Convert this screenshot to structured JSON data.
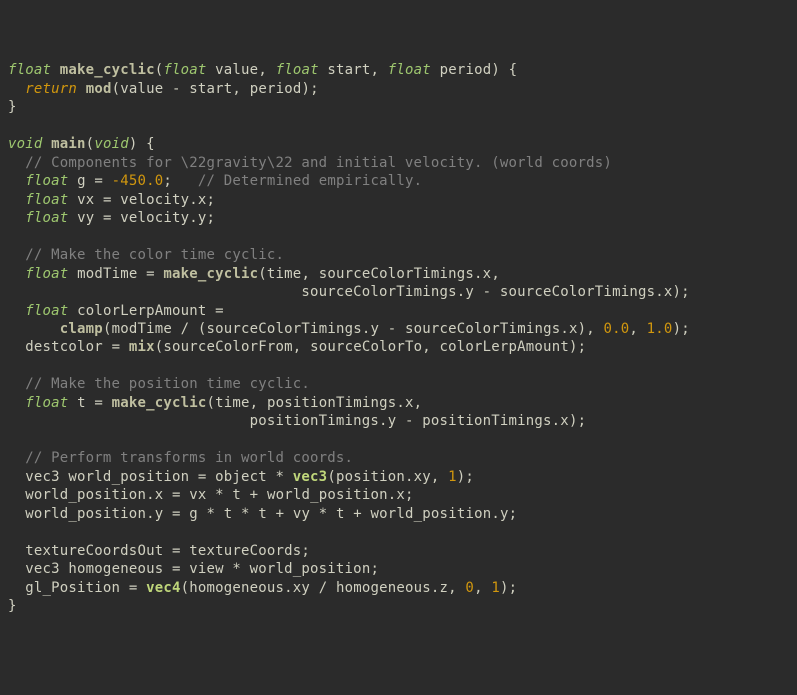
{
  "code": {
    "lines": [
      [
        {
          "t": "type",
          "s": "float"
        },
        {
          "t": "sp",
          "s": " "
        },
        {
          "t": "func",
          "s": "make_cyclic"
        },
        {
          "t": "punct",
          "s": "("
        },
        {
          "t": "type",
          "s": "float"
        },
        {
          "t": "sp",
          "s": " "
        },
        {
          "t": "ident",
          "s": "value"
        },
        {
          "t": "punct",
          "s": ", "
        },
        {
          "t": "type",
          "s": "float"
        },
        {
          "t": "sp",
          "s": " "
        },
        {
          "t": "ident",
          "s": "start"
        },
        {
          "t": "punct",
          "s": ", "
        },
        {
          "t": "type",
          "s": "float"
        },
        {
          "t": "sp",
          "s": " "
        },
        {
          "t": "ident",
          "s": "period"
        },
        {
          "t": "punct",
          "s": ") {"
        }
      ],
      [
        {
          "t": "sp",
          "s": "  "
        },
        {
          "t": "kw",
          "s": "return"
        },
        {
          "t": "sp",
          "s": " "
        },
        {
          "t": "func",
          "s": "mod"
        },
        {
          "t": "punct",
          "s": "("
        },
        {
          "t": "ident",
          "s": "value"
        },
        {
          "t": "op",
          "s": " - "
        },
        {
          "t": "ident",
          "s": "start"
        },
        {
          "t": "punct",
          "s": ", "
        },
        {
          "t": "ident",
          "s": "period"
        },
        {
          "t": "punct",
          "s": ");"
        }
      ],
      [
        {
          "t": "punct",
          "s": "}"
        }
      ],
      [
        {
          "t": "sp",
          "s": ""
        }
      ],
      [
        {
          "t": "type",
          "s": "void"
        },
        {
          "t": "sp",
          "s": " "
        },
        {
          "t": "func",
          "s": "main"
        },
        {
          "t": "punct",
          "s": "("
        },
        {
          "t": "type",
          "s": "void"
        },
        {
          "t": "punct",
          "s": ") {"
        }
      ],
      [
        {
          "t": "sp",
          "s": "  "
        },
        {
          "t": "comment",
          "s": "// Components for \\22gravity\\22 and initial velocity. (world coords)"
        }
      ],
      [
        {
          "t": "sp",
          "s": "  "
        },
        {
          "t": "type",
          "s": "float"
        },
        {
          "t": "sp",
          "s": " "
        },
        {
          "t": "ident",
          "s": "g"
        },
        {
          "t": "op",
          "s": " = "
        },
        {
          "t": "num",
          "s": "-450.0"
        },
        {
          "t": "punct",
          "s": ";"
        },
        {
          "t": "sp",
          "s": "   "
        },
        {
          "t": "comment",
          "s": "// Determined empirically."
        }
      ],
      [
        {
          "t": "sp",
          "s": "  "
        },
        {
          "t": "type",
          "s": "float"
        },
        {
          "t": "sp",
          "s": " "
        },
        {
          "t": "ident",
          "s": "vx"
        },
        {
          "t": "op",
          "s": " = "
        },
        {
          "t": "ident",
          "s": "velocity"
        },
        {
          "t": "punct",
          "s": "."
        },
        {
          "t": "ident",
          "s": "x"
        },
        {
          "t": "punct",
          "s": ";"
        }
      ],
      [
        {
          "t": "sp",
          "s": "  "
        },
        {
          "t": "type",
          "s": "float"
        },
        {
          "t": "sp",
          "s": " "
        },
        {
          "t": "ident",
          "s": "vy"
        },
        {
          "t": "op",
          "s": " = "
        },
        {
          "t": "ident",
          "s": "velocity"
        },
        {
          "t": "punct",
          "s": "."
        },
        {
          "t": "ident",
          "s": "y"
        },
        {
          "t": "punct",
          "s": ";"
        }
      ],
      [
        {
          "t": "sp",
          "s": ""
        }
      ],
      [
        {
          "t": "sp",
          "s": "  "
        },
        {
          "t": "comment",
          "s": "// Make the color time cyclic."
        }
      ],
      [
        {
          "t": "sp",
          "s": "  "
        },
        {
          "t": "type",
          "s": "float"
        },
        {
          "t": "sp",
          "s": " "
        },
        {
          "t": "ident",
          "s": "modTime"
        },
        {
          "t": "op",
          "s": " = "
        },
        {
          "t": "func",
          "s": "make_cyclic"
        },
        {
          "t": "punct",
          "s": "("
        },
        {
          "t": "ident",
          "s": "time"
        },
        {
          "t": "punct",
          "s": ", "
        },
        {
          "t": "ident",
          "s": "sourceColorTimings"
        },
        {
          "t": "punct",
          "s": "."
        },
        {
          "t": "ident",
          "s": "x"
        },
        {
          "t": "punct",
          "s": ","
        }
      ],
      [
        {
          "t": "sp",
          "s": "                                  "
        },
        {
          "t": "ident",
          "s": "sourceColorTimings"
        },
        {
          "t": "punct",
          "s": "."
        },
        {
          "t": "ident",
          "s": "y"
        },
        {
          "t": "op",
          "s": " - "
        },
        {
          "t": "ident",
          "s": "sourceColorTimings"
        },
        {
          "t": "punct",
          "s": "."
        },
        {
          "t": "ident",
          "s": "x"
        },
        {
          "t": "punct",
          "s": ");"
        }
      ],
      [
        {
          "t": "sp",
          "s": "  "
        },
        {
          "t": "type",
          "s": "float"
        },
        {
          "t": "sp",
          "s": " "
        },
        {
          "t": "ident",
          "s": "colorLerpAmount"
        },
        {
          "t": "op",
          "s": " ="
        }
      ],
      [
        {
          "t": "sp",
          "s": "      "
        },
        {
          "t": "func",
          "s": "clamp"
        },
        {
          "t": "punct",
          "s": "("
        },
        {
          "t": "ident",
          "s": "modTime"
        },
        {
          "t": "op",
          "s": " / "
        },
        {
          "t": "punct",
          "s": "("
        },
        {
          "t": "ident",
          "s": "sourceColorTimings"
        },
        {
          "t": "punct",
          "s": "."
        },
        {
          "t": "ident",
          "s": "y"
        },
        {
          "t": "op",
          "s": " - "
        },
        {
          "t": "ident",
          "s": "sourceColorTimings"
        },
        {
          "t": "punct",
          "s": "."
        },
        {
          "t": "ident",
          "s": "x"
        },
        {
          "t": "punct",
          "s": "), "
        },
        {
          "t": "num",
          "s": "0.0"
        },
        {
          "t": "punct",
          "s": ", "
        },
        {
          "t": "num",
          "s": "1.0"
        },
        {
          "t": "punct",
          "s": ");"
        }
      ],
      [
        {
          "t": "sp",
          "s": "  "
        },
        {
          "t": "ident",
          "s": "destcolor"
        },
        {
          "t": "op",
          "s": " = "
        },
        {
          "t": "func",
          "s": "mix"
        },
        {
          "t": "punct",
          "s": "("
        },
        {
          "t": "ident",
          "s": "sourceColorFrom"
        },
        {
          "t": "punct",
          "s": ", "
        },
        {
          "t": "ident",
          "s": "sourceColorTo"
        },
        {
          "t": "punct",
          "s": ", "
        },
        {
          "t": "ident",
          "s": "colorLerpAmount"
        },
        {
          "t": "punct",
          "s": ");"
        }
      ],
      [
        {
          "t": "sp",
          "s": ""
        }
      ],
      [
        {
          "t": "sp",
          "s": "  "
        },
        {
          "t": "comment",
          "s": "// Make the position time cyclic."
        }
      ],
      [
        {
          "t": "sp",
          "s": "  "
        },
        {
          "t": "type",
          "s": "float"
        },
        {
          "t": "sp",
          "s": " "
        },
        {
          "t": "ident",
          "s": "t"
        },
        {
          "t": "op",
          "s": " = "
        },
        {
          "t": "func",
          "s": "make_cyclic"
        },
        {
          "t": "punct",
          "s": "("
        },
        {
          "t": "ident",
          "s": "time"
        },
        {
          "t": "punct",
          "s": ", "
        },
        {
          "t": "ident",
          "s": "positionTimings"
        },
        {
          "t": "punct",
          "s": "."
        },
        {
          "t": "ident",
          "s": "x"
        },
        {
          "t": "punct",
          "s": ","
        }
      ],
      [
        {
          "t": "sp",
          "s": "                            "
        },
        {
          "t": "ident",
          "s": "positionTimings"
        },
        {
          "t": "punct",
          "s": "."
        },
        {
          "t": "ident",
          "s": "y"
        },
        {
          "t": "op",
          "s": " - "
        },
        {
          "t": "ident",
          "s": "positionTimings"
        },
        {
          "t": "punct",
          "s": "."
        },
        {
          "t": "ident",
          "s": "x"
        },
        {
          "t": "punct",
          "s": ");"
        }
      ],
      [
        {
          "t": "sp",
          "s": ""
        }
      ],
      [
        {
          "t": "sp",
          "s": "  "
        },
        {
          "t": "comment",
          "s": "// Perform transforms in world coords."
        }
      ],
      [
        {
          "t": "sp",
          "s": "  "
        },
        {
          "t": "ident",
          "s": "vec3"
        },
        {
          "t": "sp",
          "s": " "
        },
        {
          "t": "ident",
          "s": "world_position"
        },
        {
          "t": "op",
          "s": " = "
        },
        {
          "t": "ident",
          "s": "object"
        },
        {
          "t": "op",
          "s": " * "
        },
        {
          "t": "builtin",
          "s": "vec3"
        },
        {
          "t": "punct",
          "s": "("
        },
        {
          "t": "ident",
          "s": "position"
        },
        {
          "t": "punct",
          "s": "."
        },
        {
          "t": "ident",
          "s": "xy"
        },
        {
          "t": "punct",
          "s": ", "
        },
        {
          "t": "num",
          "s": "1"
        },
        {
          "t": "punct",
          "s": ");"
        }
      ],
      [
        {
          "t": "sp",
          "s": "  "
        },
        {
          "t": "ident",
          "s": "world_position"
        },
        {
          "t": "punct",
          "s": "."
        },
        {
          "t": "ident",
          "s": "x"
        },
        {
          "t": "op",
          "s": " = "
        },
        {
          "t": "ident",
          "s": "vx"
        },
        {
          "t": "op",
          "s": " * "
        },
        {
          "t": "ident",
          "s": "t"
        },
        {
          "t": "op",
          "s": " + "
        },
        {
          "t": "ident",
          "s": "world_position"
        },
        {
          "t": "punct",
          "s": "."
        },
        {
          "t": "ident",
          "s": "x"
        },
        {
          "t": "punct",
          "s": ";"
        }
      ],
      [
        {
          "t": "sp",
          "s": "  "
        },
        {
          "t": "ident",
          "s": "world_position"
        },
        {
          "t": "punct",
          "s": "."
        },
        {
          "t": "ident",
          "s": "y"
        },
        {
          "t": "op",
          "s": " = "
        },
        {
          "t": "ident",
          "s": "g"
        },
        {
          "t": "op",
          "s": " * "
        },
        {
          "t": "ident",
          "s": "t"
        },
        {
          "t": "op",
          "s": " * "
        },
        {
          "t": "ident",
          "s": "t"
        },
        {
          "t": "op",
          "s": " + "
        },
        {
          "t": "ident",
          "s": "vy"
        },
        {
          "t": "op",
          "s": " * "
        },
        {
          "t": "ident",
          "s": "t"
        },
        {
          "t": "op",
          "s": " + "
        },
        {
          "t": "ident",
          "s": "world_position"
        },
        {
          "t": "punct",
          "s": "."
        },
        {
          "t": "ident",
          "s": "y"
        },
        {
          "t": "punct",
          "s": ";"
        }
      ],
      [
        {
          "t": "sp",
          "s": ""
        }
      ],
      [
        {
          "t": "sp",
          "s": "  "
        },
        {
          "t": "ident",
          "s": "textureCoordsOut"
        },
        {
          "t": "op",
          "s": " = "
        },
        {
          "t": "ident",
          "s": "textureCoords"
        },
        {
          "t": "punct",
          "s": ";"
        }
      ],
      [
        {
          "t": "sp",
          "s": "  "
        },
        {
          "t": "ident",
          "s": "vec3"
        },
        {
          "t": "sp",
          "s": " "
        },
        {
          "t": "ident",
          "s": "homogeneous"
        },
        {
          "t": "op",
          "s": " = "
        },
        {
          "t": "ident",
          "s": "view"
        },
        {
          "t": "op",
          "s": " * "
        },
        {
          "t": "ident",
          "s": "world_position"
        },
        {
          "t": "punct",
          "s": ";"
        }
      ],
      [
        {
          "t": "sp",
          "s": "  "
        },
        {
          "t": "ident",
          "s": "gl_Position"
        },
        {
          "t": "op",
          "s": " = "
        },
        {
          "t": "builtin",
          "s": "vec4"
        },
        {
          "t": "punct",
          "s": "("
        },
        {
          "t": "ident",
          "s": "homogeneous"
        },
        {
          "t": "punct",
          "s": "."
        },
        {
          "t": "ident",
          "s": "xy"
        },
        {
          "t": "op",
          "s": " / "
        },
        {
          "t": "ident",
          "s": "homogeneous"
        },
        {
          "t": "punct",
          "s": "."
        },
        {
          "t": "ident",
          "s": "z"
        },
        {
          "t": "punct",
          "s": ", "
        },
        {
          "t": "num",
          "s": "0"
        },
        {
          "t": "punct",
          "s": ", "
        },
        {
          "t": "num",
          "s": "1"
        },
        {
          "t": "punct",
          "s": ");"
        }
      ],
      [
        {
          "t": "punct",
          "s": "}"
        }
      ]
    ]
  }
}
